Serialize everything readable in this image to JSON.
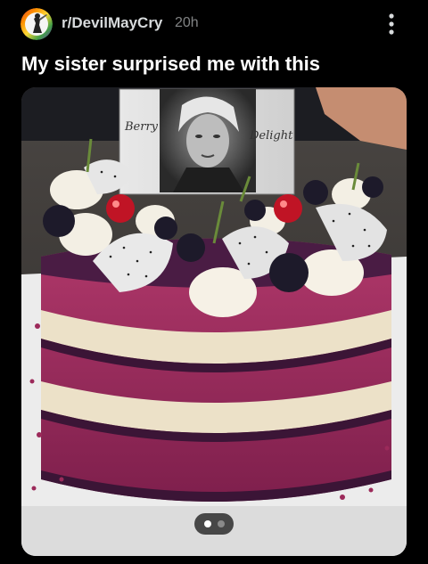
{
  "post": {
    "subreddit": "r/DevilMayCry",
    "time_ago": "20h",
    "title": "My sister surprised me with this"
  },
  "image": {
    "photo_card": {
      "word_left": "Berry",
      "word_right": "Delight"
    },
    "carousel": {
      "current_index": 1,
      "total": 2
    }
  },
  "icons": {
    "avatar": "subreddit-avatar-icon",
    "more": "more-options-icon"
  },
  "colors": {
    "background": "#000000",
    "title_text": "#ffffff",
    "subreddit_text": "#d7dadc",
    "meta_text": "#818384"
  }
}
